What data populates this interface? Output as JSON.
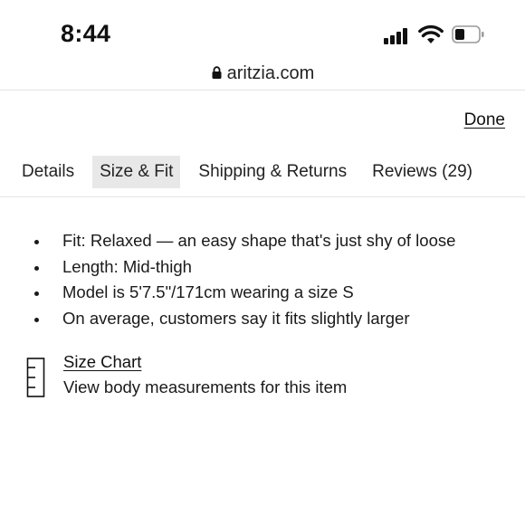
{
  "status_bar": {
    "time": "8:44",
    "icons": [
      "cellular-signal-icon",
      "wifi-icon",
      "battery-icon"
    ]
  },
  "url_bar": {
    "domain": "aritzia.com",
    "icon": "lock-icon"
  },
  "header": {
    "done_label": "Done"
  },
  "tabs": [
    {
      "label": "Details",
      "active": false
    },
    {
      "label": "Size & Fit",
      "active": true
    },
    {
      "label": "Shipping & Returns",
      "active": false
    },
    {
      "label": "Reviews (29)",
      "active": false
    }
  ],
  "fit_details": [
    "Fit: Relaxed — an easy shape that's just shy of loose",
    "Length: Mid-thigh",
    "Model is 5'7.5\"/171cm wearing a size S",
    "On average, customers say it fits slightly larger"
  ],
  "size_chart": {
    "icon": "ruler-icon",
    "link_label": "Size Chart",
    "description": "View body measurements for this item"
  },
  "colors": {
    "text": "#1a1a1a",
    "active_tab_bg": "#e8e8e8",
    "divider": "#e3e3e3"
  }
}
